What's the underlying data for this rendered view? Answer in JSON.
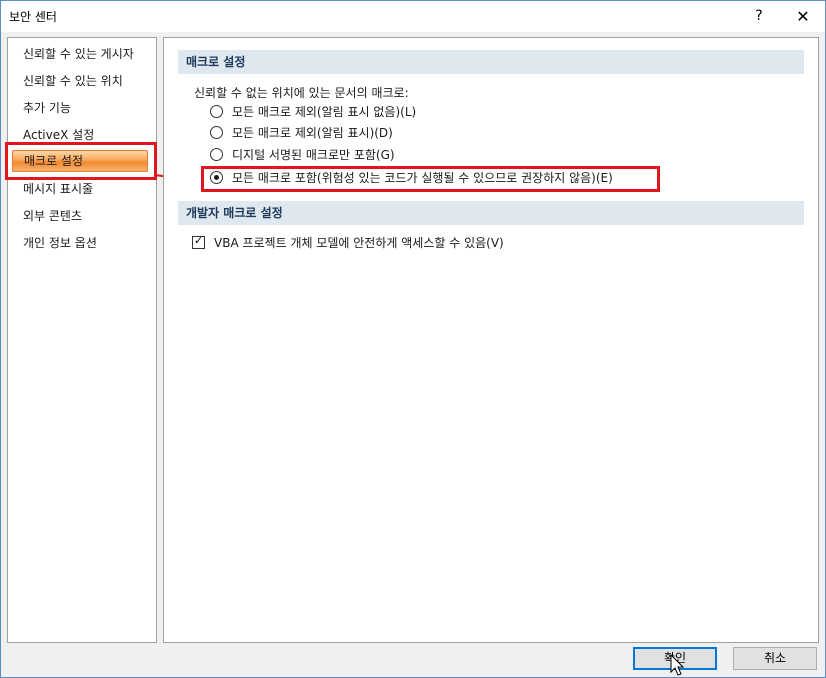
{
  "window": {
    "title": "보안 센터",
    "help_label": "?",
    "close_label": "✕"
  },
  "sidebar": {
    "items": [
      {
        "label": "신뢰할 수 있는 게시자"
      },
      {
        "label": "신뢰할 수 있는 위치"
      },
      {
        "label": "추가 기능"
      },
      {
        "label": "ActiveX 설정"
      },
      {
        "label": "매크로 설정",
        "selected": true
      },
      {
        "label": "메시지 표시줄"
      },
      {
        "label": "외부 콘텐츠"
      },
      {
        "label": "개인 정보 옵션"
      }
    ]
  },
  "macro_section": {
    "header": "매크로 설정",
    "description": "신뢰할 수 없는 위치에 있는 문서의 매크로:",
    "options": [
      {
        "label": "모든 매크로 제외(알림 표시 없음)(L)",
        "checked": false
      },
      {
        "label": "모든 매크로 제외(알림 표시)(D)",
        "checked": false
      },
      {
        "label": "디지털 서명된 매크로만 포함(G)",
        "checked": false
      },
      {
        "label": "모든 매크로 포함(위험성 있는 코드가 실행될 수 있으므로 권장하지 않음)(E)",
        "checked": true
      }
    ]
  },
  "developer_section": {
    "header": "개발자 매크로 설정",
    "checkbox_label": "VBA 프로젝트 개체 모델에 안전하게 액세스할 수 있음(V)",
    "checkbox_checked": true
  },
  "buttons": {
    "ok": "확인",
    "cancel": "취소"
  },
  "colors": {
    "annotation": "#e0161e",
    "selection": "#f8a75a",
    "section_header": "#dfe7ef"
  }
}
